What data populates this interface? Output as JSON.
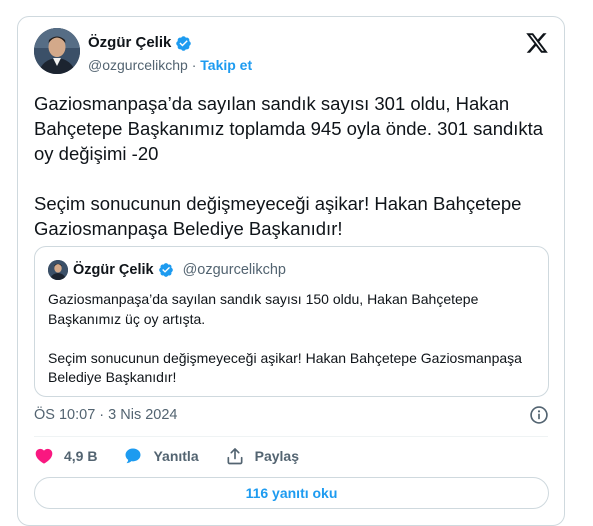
{
  "author": {
    "name": "Özgür Çelik",
    "handle": "@ozgurcelikchp",
    "separator": "·",
    "follow_label": "Takip et"
  },
  "tweet": {
    "paragraphs": [
      "Gaziosmanpaşa’da sayılan sandık sayısı 301 oldu, Hakan Bahçetepe Başkanımız toplamda 945 oyla önde. 301 sandıkta oy değişimi -20",
      "Seçim sonucunun değişmeyeceği aşikar! Hakan Bahçetepe Gaziosmanpaşa Belediye Başkanıdır!"
    ]
  },
  "quoted_tweet": {
    "name": "Özgür Çelik",
    "handle": "@ozgurcelikchp",
    "paragraphs": [
      "Gaziosmanpaşa’da sayılan sandık sayısı 150 oldu, Hakan Bahçetepe Başkanımız üç oy artışta.",
      "Seçim sonucunun değişmeyeceği aşikar! Hakan Bahçetepe Gaziosmanpaşa Belediye Başkanıdır!"
    ]
  },
  "meta": {
    "time": "ÖS 10:07",
    "separator": "·",
    "date": "3 Nis 2024"
  },
  "actions": {
    "like_count": "4,9 B",
    "reply_label": "Yanıtla",
    "share_label": "Paylaş"
  },
  "replies_button_label": "116 yanıtı oku",
  "icons": {
    "verified": "verified-badge-icon",
    "brand": "x-logo-icon",
    "info": "info-icon",
    "like": "heart-icon",
    "reply": "speech-bubble-icon",
    "share": "share-upload-icon"
  },
  "colors": {
    "accent": "#1d9bf0",
    "like": "#f91880",
    "text": "#0f1419",
    "muted": "#536471",
    "border": "#cfd9de"
  }
}
